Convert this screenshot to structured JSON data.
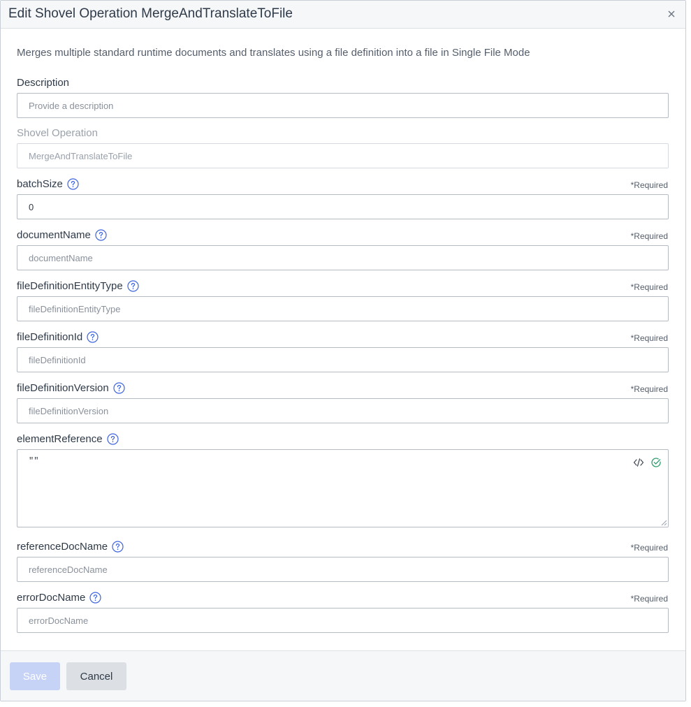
{
  "dialog": {
    "title": "Edit Shovel Operation MergeAndTranslateToFile",
    "intro": "Merges multiple standard runtime documents and translates using a file definition into a file in Single File Mode"
  },
  "required_label": "*Required",
  "fields": {
    "description": {
      "label": "Description",
      "value": "",
      "placeholder": "Provide a description"
    },
    "shovel_operation": {
      "label": "Shovel Operation",
      "value": "",
      "placeholder": "MergeAndTranslateToFile"
    },
    "batch_size": {
      "label": "batchSize",
      "value": "0",
      "placeholder": ""
    },
    "document_name": {
      "label": "documentName",
      "value": "",
      "placeholder": "documentName"
    },
    "file_definition_entity_type": {
      "label": "fileDefinitionEntityType",
      "value": "",
      "placeholder": "fileDefinitionEntityType"
    },
    "file_definition_id": {
      "label": "fileDefinitionId",
      "value": "",
      "placeholder": "fileDefinitionId"
    },
    "file_definition_version": {
      "label": "fileDefinitionVersion",
      "value": "",
      "placeholder": "fileDefinitionVersion"
    },
    "element_reference": {
      "label": "elementReference",
      "value": "\"\""
    },
    "reference_doc_name": {
      "label": "referenceDocName",
      "value": "",
      "placeholder": "referenceDocName"
    },
    "error_doc_name": {
      "label": "errorDocName",
      "value": "",
      "placeholder": "errorDocName"
    }
  },
  "footer": {
    "save_label": "Save",
    "cancel_label": "Cancel"
  },
  "icons": {
    "close": "close-icon",
    "help": "help-circle-icon",
    "code": "code-icon",
    "valid": "check-circle-icon"
  },
  "colors": {
    "accent": "#3d63dd",
    "valid": "#2e9e6e",
    "save_disabled": "#c6d3f6"
  }
}
